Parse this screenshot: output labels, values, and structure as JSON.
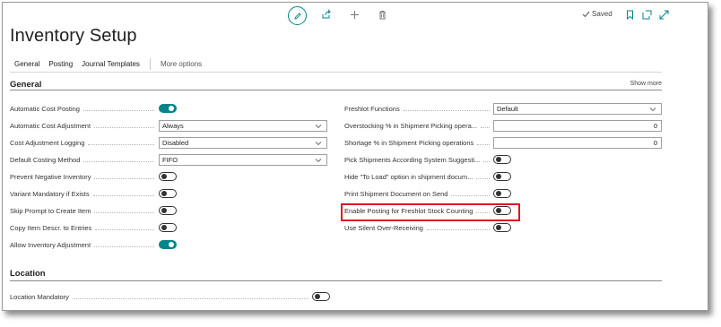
{
  "toolbar": {
    "edit_icon": "pencil-icon",
    "share_icon": "share-icon",
    "new_icon": "plus-icon",
    "delete_icon": "trash-icon",
    "saved_label": "Saved",
    "bookmark_icon": "bookmark-icon",
    "open_new_window_icon": "open-in-new-window-icon",
    "expand_icon": "expand-icon",
    "accent_color": "#00858a"
  },
  "page": {
    "title": "Inventory Setup"
  },
  "tabs": [
    "General",
    "Posting",
    "Journal Templates",
    "More options"
  ],
  "general": {
    "header": "General",
    "show_more": "Show more",
    "left_fields": [
      {
        "label": "Automatic Cost Posting",
        "type": "toggle",
        "value": true
      },
      {
        "label": "Automatic Cost Adjustment",
        "type": "select",
        "value": "Always"
      },
      {
        "label": "Cost Adjustment Logging",
        "type": "select",
        "value": "Disabled"
      },
      {
        "label": "Default Costing Method",
        "type": "select",
        "value": "FIFO"
      },
      {
        "label": "Prevent Negative Inventory",
        "type": "toggle",
        "value": false
      },
      {
        "label": "Variant Mandatory if Exists",
        "type": "toggle",
        "value": false
      },
      {
        "label": "Skip Prompt to Create Item",
        "type": "toggle",
        "value": false
      },
      {
        "label": "Copy Item Descr. to Entries",
        "type": "toggle",
        "value": false
      },
      {
        "label": "Allow Inventory Adjustment",
        "type": "toggle",
        "value": true
      }
    ],
    "right_fields": [
      {
        "label": "Freshlot Functions",
        "type": "select",
        "value": "Default"
      },
      {
        "label": "Overstocking % in Shipment Picking opera...",
        "type": "text",
        "value": "0"
      },
      {
        "label": "Shortage % in Shipment Picking operations",
        "type": "text",
        "value": "0"
      },
      {
        "label": "Pick Shipments According System Suggesti...",
        "type": "toggle",
        "value": false
      },
      {
        "label": "Hide \"To Load\" option in shipment docum...",
        "type": "toggle",
        "value": false
      },
      {
        "label": "Print Shipment Document on Send",
        "type": "toggle",
        "value": false
      },
      {
        "label": "Enable Posting for Freshlot Stock Counting",
        "type": "toggle",
        "value": false,
        "highlighted": true
      },
      {
        "label": "Use Silent Over-Receiving",
        "type": "toggle",
        "value": false
      }
    ]
  },
  "location": {
    "header": "Location",
    "fields": [
      {
        "label": "Location Mandatory",
        "type": "toggle",
        "value": false
      }
    ]
  },
  "highlight_color": "#e0161d"
}
